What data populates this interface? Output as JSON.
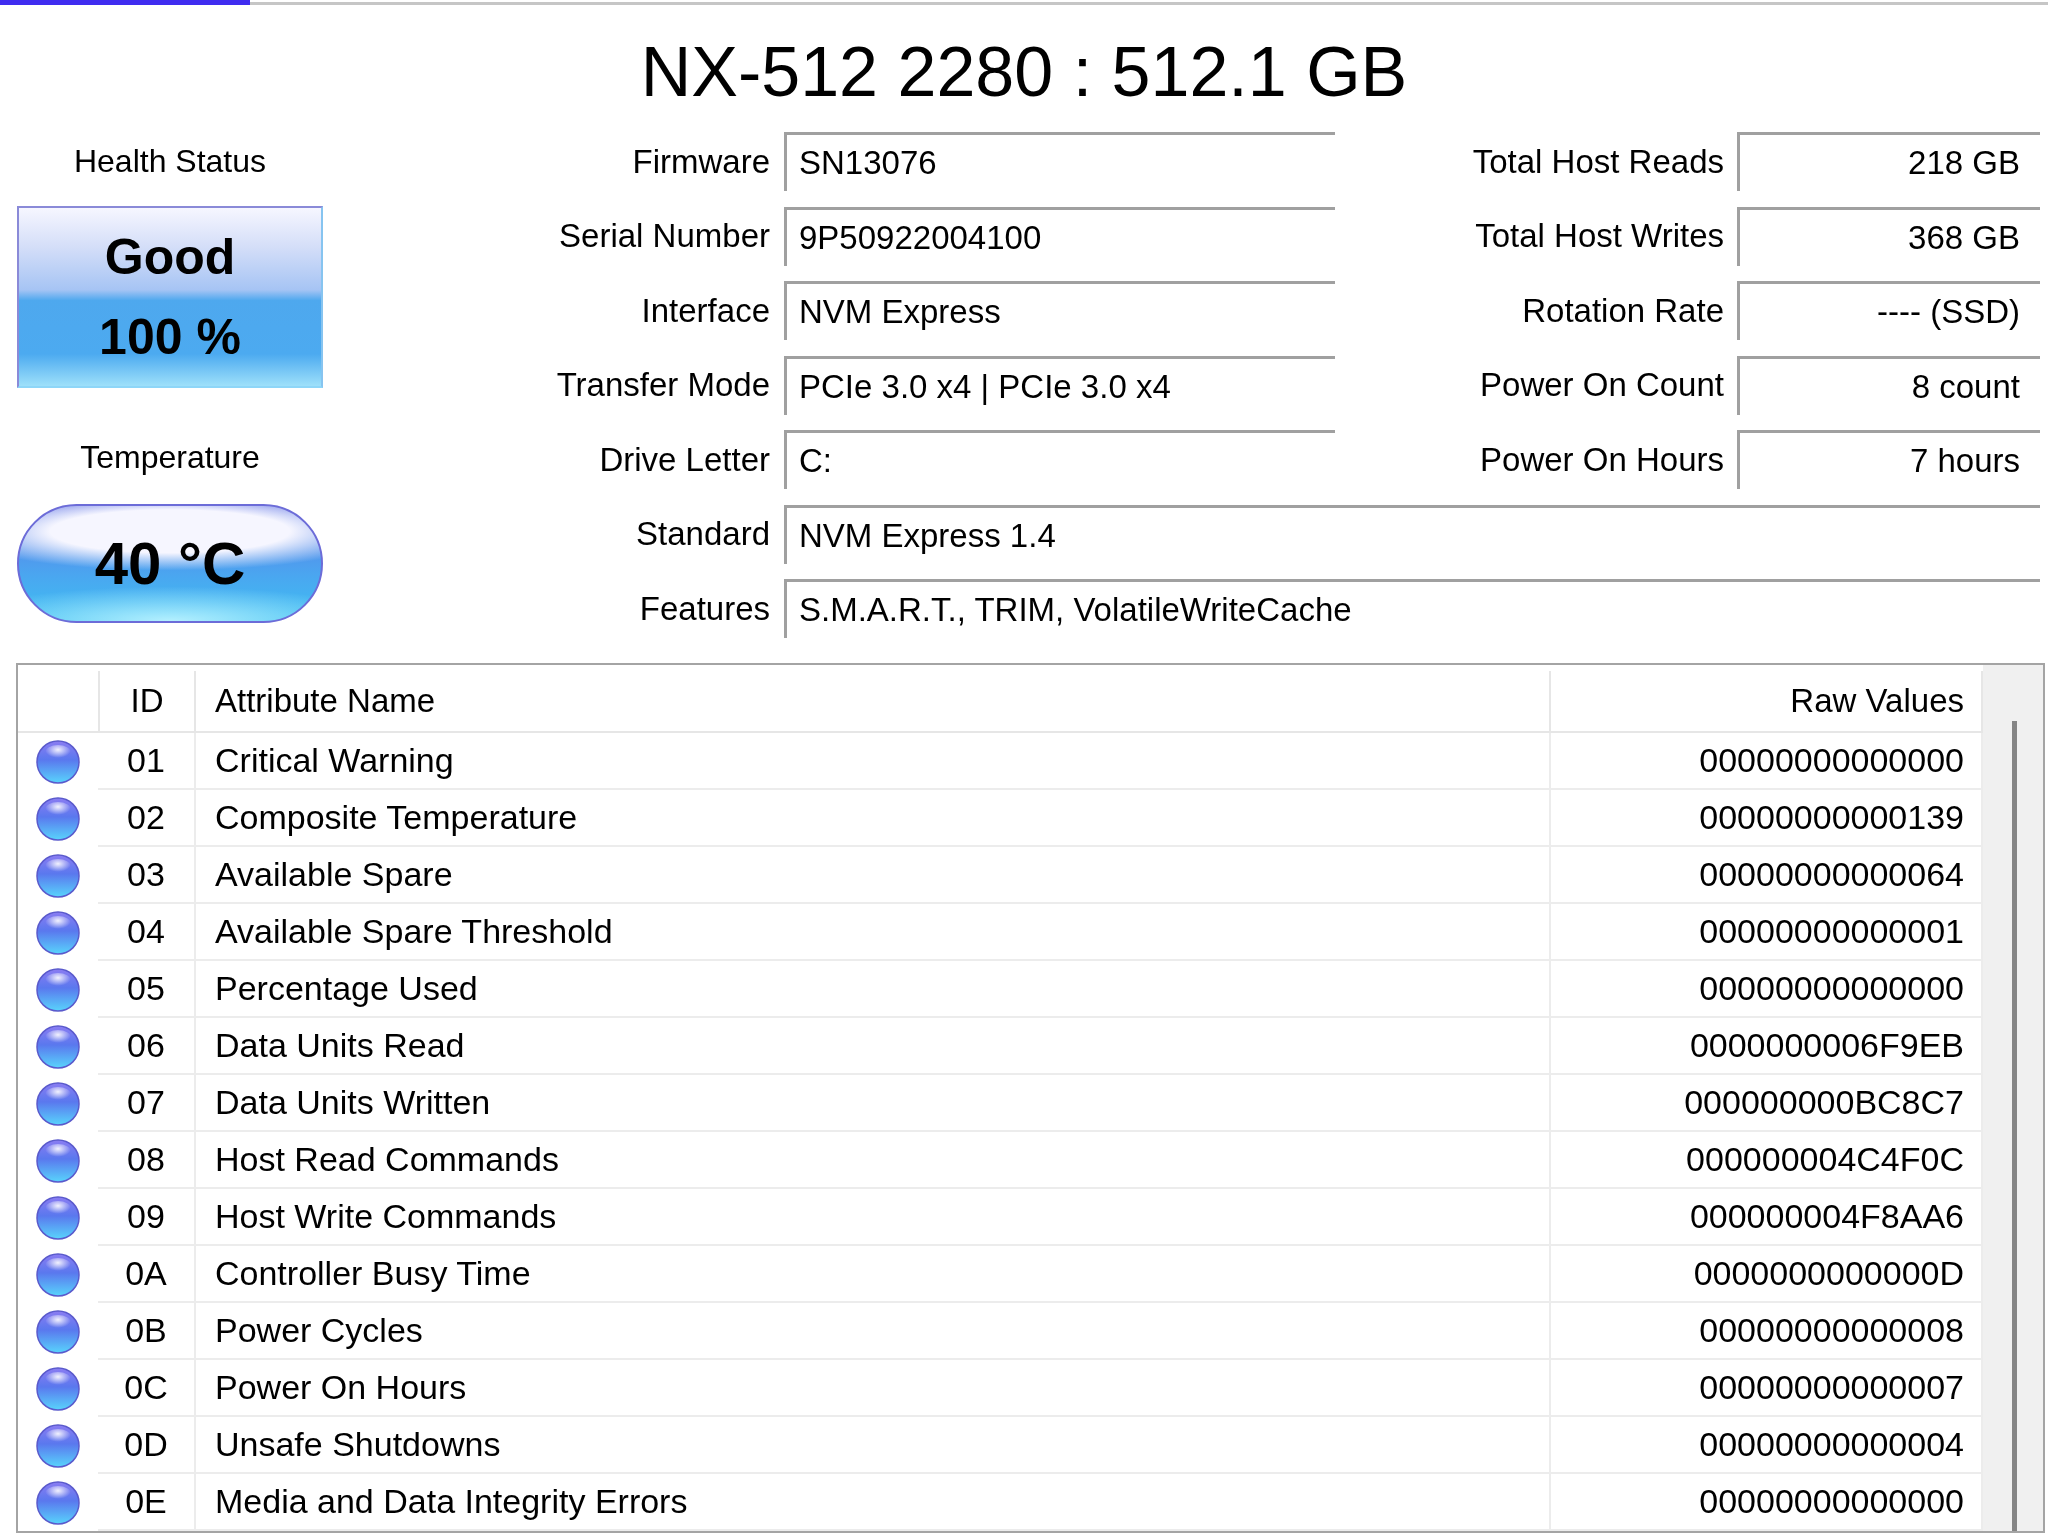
{
  "progress": {
    "level": 0.122
  },
  "title": "NX-512 2280 : 512.1 GB",
  "health": {
    "label": "Health Status",
    "status": "Good",
    "percent": "100 %"
  },
  "temperature": {
    "label": "Temperature",
    "value": "40 °C"
  },
  "details": [
    {
      "label": "Firmware",
      "value": "SN13076"
    },
    {
      "label": "Serial Number",
      "value": "9P50922004100"
    },
    {
      "label": "Interface",
      "value": "NVM Express"
    },
    {
      "label": "Transfer Mode",
      "value": "PCIe 3.0 x4 | PCIe 3.0 x4"
    },
    {
      "label": "Drive Letter",
      "value": "C:"
    },
    {
      "label": "Standard",
      "value": "NVM Express 1.4"
    },
    {
      "label": "Features",
      "value": "S.M.A.R.T., TRIM, VolatileWriteCache"
    }
  ],
  "counters": [
    {
      "label": "Total Host Reads",
      "value": "218 GB"
    },
    {
      "label": "Total Host Writes",
      "value": "368 GB"
    },
    {
      "label": "Rotation Rate",
      "value": "---- (SSD)"
    },
    {
      "label": "Power On Count",
      "value": "8 count"
    },
    {
      "label": "Power On Hours",
      "value": "7 hours"
    }
  ],
  "table": {
    "columns": [
      "ID",
      "Attribute Name",
      "Raw Values"
    ],
    "rows": [
      {
        "id": "01",
        "name": "Critical Warning",
        "raw": "00000000000000"
      },
      {
        "id": "02",
        "name": "Composite Temperature",
        "raw": "00000000000139"
      },
      {
        "id": "03",
        "name": "Available Spare",
        "raw": "00000000000064"
      },
      {
        "id": "04",
        "name": "Available Spare Threshold",
        "raw": "00000000000001"
      },
      {
        "id": "05",
        "name": "Percentage Used",
        "raw": "00000000000000"
      },
      {
        "id": "06",
        "name": "Data Units Read",
        "raw": "0000000006F9EB"
      },
      {
        "id": "07",
        "name": "Data Units Written",
        "raw": "000000000BC8C7"
      },
      {
        "id": "08",
        "name": "Host Read Commands",
        "raw": "000000004C4F0C"
      },
      {
        "id": "09",
        "name": "Host Write Commands",
        "raw": "000000004F8AA6"
      },
      {
        "id": "0A",
        "name": "Controller Busy Time",
        "raw": "0000000000000D"
      },
      {
        "id": "0B",
        "name": "Power Cycles",
        "raw": "00000000000008"
      },
      {
        "id": "0C",
        "name": "Power On Hours",
        "raw": "00000000000007"
      },
      {
        "id": "0D",
        "name": "Unsafe Shutdowns",
        "raw": "00000000000004"
      },
      {
        "id": "0E",
        "name": "Media and Data Integrity Errors",
        "raw": "00000000000000"
      }
    ]
  }
}
